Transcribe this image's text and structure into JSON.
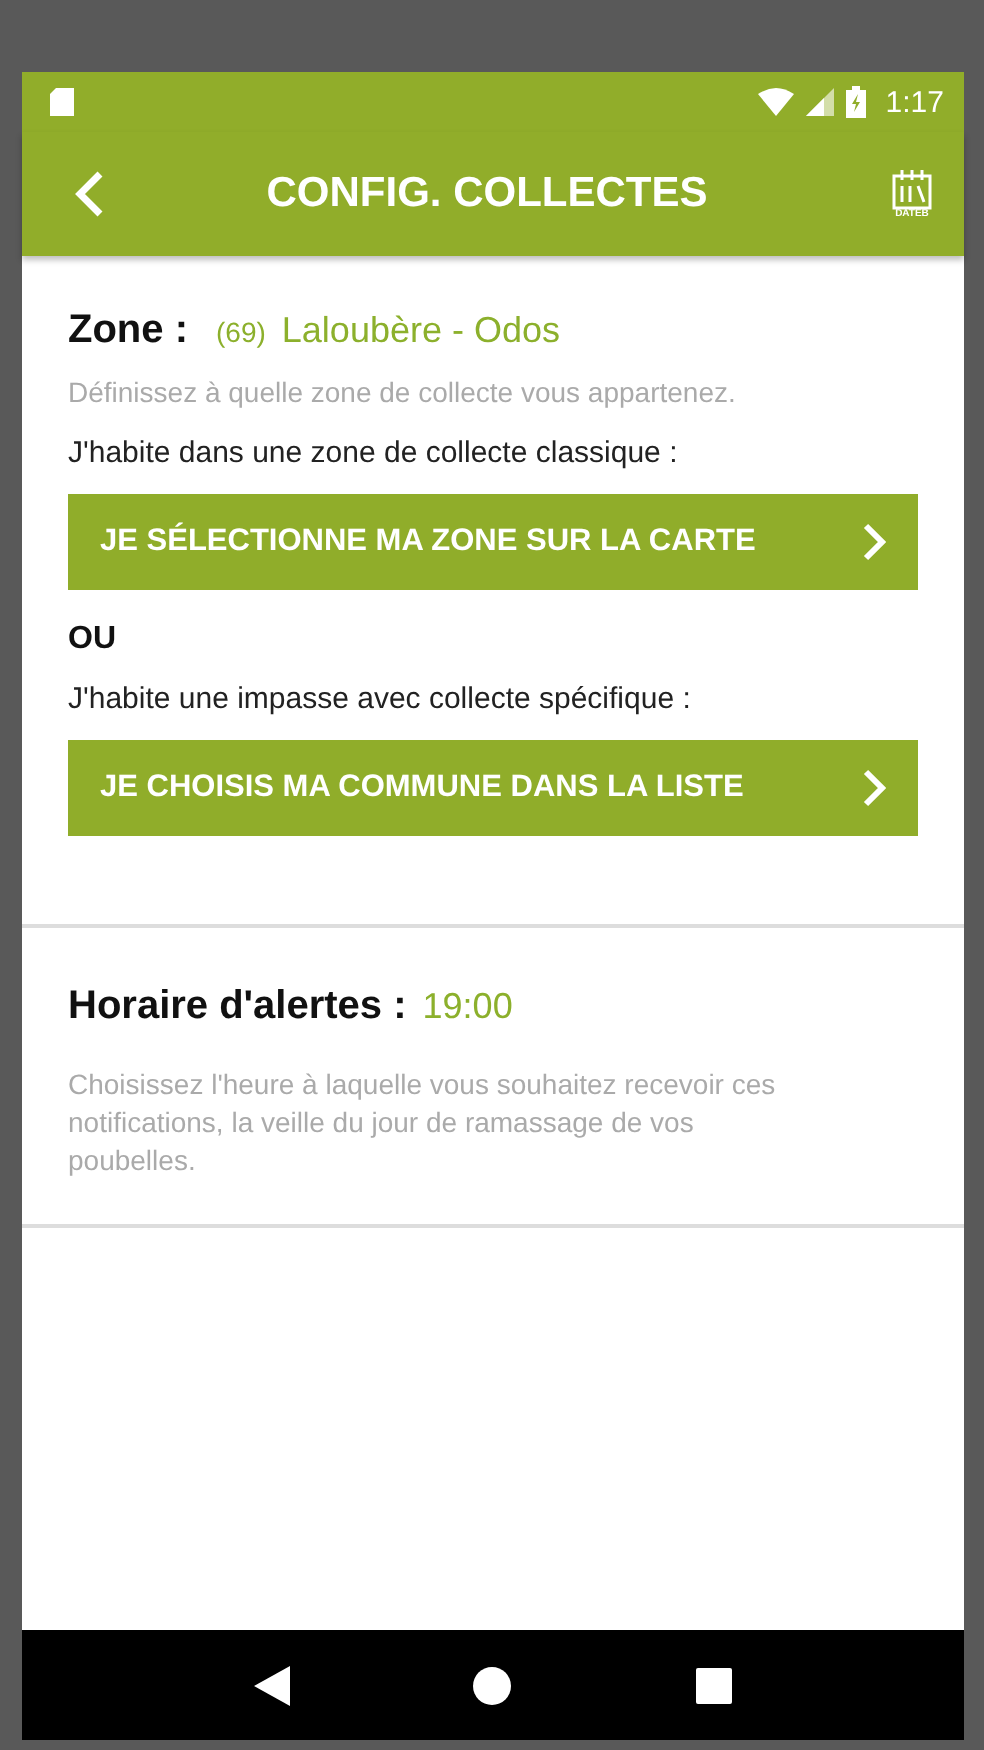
{
  "status_bar": {
    "time": "1:17"
  },
  "header": {
    "title": "CONFIG. COLLECTES",
    "logo_label": "DATEB"
  },
  "zone": {
    "label": "Zone :",
    "code": "(69)",
    "value": "Laloubère - Odos",
    "hint": "Définissez à quelle zone de collecte vous appartenez.",
    "options": [
      {
        "kind": "prompt",
        "text": "J'habite dans une zone de collecte classique :"
      },
      {
        "kind": "button",
        "text": "JE SÉLECTIONNE MA ZONE SUR LA CARTE"
      },
      {
        "kind": "separator",
        "text": "OU"
      },
      {
        "kind": "prompt",
        "text": "J'habite une impasse avec collecte spécifique :"
      },
      {
        "kind": "button",
        "text": "JE CHOISIS MA COMMUNE DANS LA LISTE"
      }
    ]
  },
  "alerts": {
    "label": "Horaire d'alertes :",
    "time": "19:00",
    "hint": "Choisissez l'heure à laquelle vous souhaitez recevoir ces notifications, la veille du jour de ramassage de vos poubelles."
  }
}
